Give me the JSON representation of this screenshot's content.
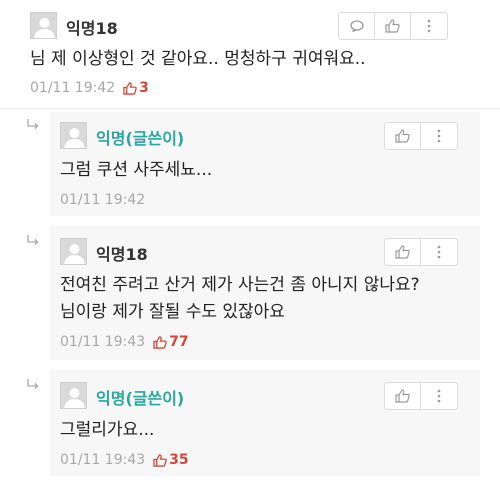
{
  "comments": [
    {
      "nick": "익명18",
      "text": "님 제 이상형인 것 같아요.. 멍청하구 귀여워요..",
      "time": "01/11 19:42",
      "likes": "3"
    }
  ],
  "replies": [
    {
      "nick": "익명(글쓴이)",
      "text": "그럼 쿠션 사주세뇨...",
      "time": "01/11 19:42",
      "likes": ""
    },
    {
      "nick": "익명18",
      "text_line1": "전여친 주려고 산거 제가 사는건 좀 아니지 않나요?",
      "text_line2": "님이랑 제가 잘될 수도 있잖아요",
      "time": "01/11 19:43",
      "likes": "77"
    },
    {
      "nick": "익명(글쓴이)",
      "text": "그럴리가요...",
      "time": "01/11 19:43",
      "likes": "35"
    }
  ],
  "icons": {
    "comment": "speech-bubble-icon",
    "like": "thumbs-up-icon",
    "more": "kebab-menu-icon",
    "reply": "reply-arrow-icon"
  },
  "colors": {
    "author_nick": "#2aa7a0",
    "likes": "#d3473a",
    "reply_bg": "#f7f7f7"
  }
}
